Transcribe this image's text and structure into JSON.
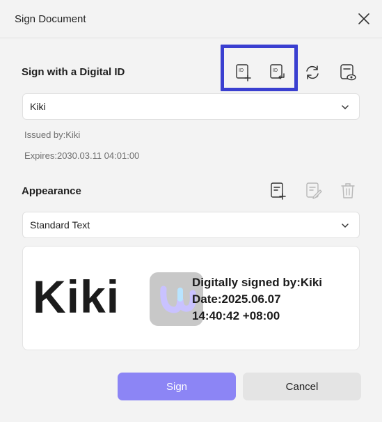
{
  "dialog": {
    "title": "Sign Document"
  },
  "digital_id": {
    "label": "Sign with a Digital ID",
    "selected": "Kiki",
    "issued_by": "Issued by:Kiki",
    "expires": "Expires:2030.03.11 04:01:00",
    "icon_badge_text": "ID"
  },
  "appearance": {
    "label": "Appearance",
    "selected": "Standard Text",
    "preview": {
      "name": "Kiki",
      "line1": "Digitally signed by:Kiki",
      "line2": "Date:2025.06.07",
      "line3": "14:40:42 +08:00"
    }
  },
  "buttons": {
    "sign": "Sign",
    "cancel": "Cancel"
  },
  "colors": {
    "accent": "#8c85f5",
    "highlight": "#3a3fd0"
  }
}
